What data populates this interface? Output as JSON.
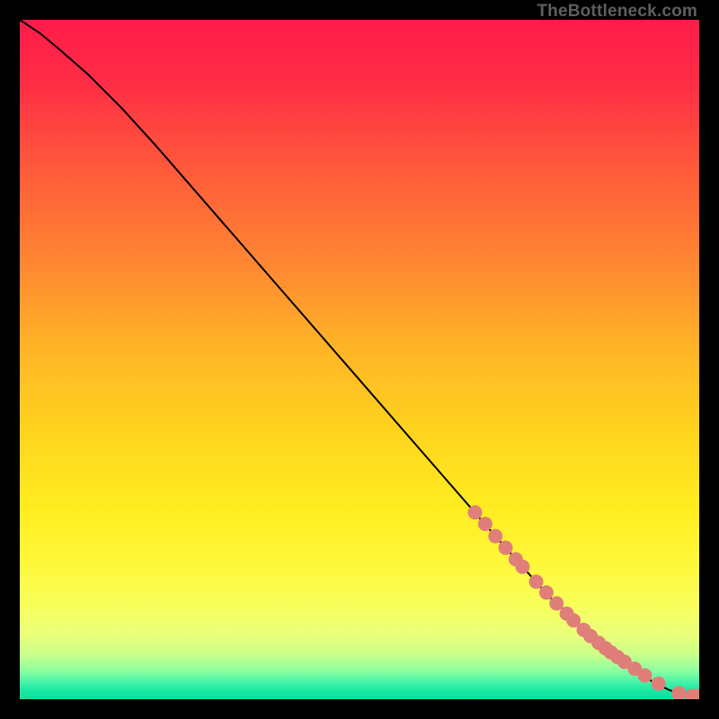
{
  "attribution": "TheBottleneck.com",
  "chart_data": {
    "type": "line",
    "title": "",
    "xlabel": "",
    "ylabel": "",
    "xlim": [
      0,
      100
    ],
    "ylim": [
      0,
      100
    ],
    "background_gradient": {
      "stops": [
        {
          "offset": 0.0,
          "color": "#ff1b4a"
        },
        {
          "offset": 0.1,
          "color": "#ff2f45"
        },
        {
          "offset": 0.22,
          "color": "#ff5a3a"
        },
        {
          "offset": 0.35,
          "color": "#ff8433"
        },
        {
          "offset": 0.48,
          "color": "#ffb327"
        },
        {
          "offset": 0.6,
          "color": "#ffd21e"
        },
        {
          "offset": 0.72,
          "color": "#ffed20"
        },
        {
          "offset": 0.8,
          "color": "#fff83a"
        },
        {
          "offset": 0.86,
          "color": "#f8ff5a"
        },
        {
          "offset": 0.905,
          "color": "#eaff7a"
        },
        {
          "offset": 0.935,
          "color": "#c8ff8a"
        },
        {
          "offset": 0.958,
          "color": "#8dffa0"
        },
        {
          "offset": 0.975,
          "color": "#46f3a8"
        },
        {
          "offset": 0.988,
          "color": "#18e7a3"
        },
        {
          "offset": 1.0,
          "color": "#0fdf9e"
        }
      ]
    },
    "series": [
      {
        "name": "curve",
        "type": "line",
        "color": "#000000",
        "x": [
          0,
          3,
          6,
          10,
          15,
          20,
          30,
          40,
          50,
          60,
          70,
          78,
          84,
          88,
          91,
          93.5,
          95.5,
          97,
          98.2,
          99,
          100
        ],
        "y": [
          100,
          98,
          95.5,
          92,
          87,
          81.5,
          70,
          58.5,
          47,
          35.5,
          24,
          15,
          9.5,
          6,
          3.8,
          2.4,
          1.4,
          0.8,
          0.5,
          0.5,
          0.5
        ]
      },
      {
        "name": "points",
        "type": "scatter",
        "color": "#e07f79",
        "radius": 8,
        "x": [
          67.0,
          68.5,
          70.0,
          71.5,
          73.0,
          74.0,
          76.0,
          77.5,
          79.0,
          80.5,
          81.5,
          83.0,
          84.0,
          85.2,
          86.2,
          87.0,
          88.0,
          89.0,
          90.5,
          92.0,
          94.0,
          97.0,
          99.0,
          100.0
        ],
        "y": [
          27.5,
          25.8,
          24.0,
          22.3,
          20.6,
          19.5,
          17.3,
          15.7,
          14.1,
          12.6,
          11.6,
          10.2,
          9.3,
          8.3,
          7.5,
          6.9,
          6.2,
          5.5,
          4.5,
          3.5,
          2.3,
          0.9,
          0.5,
          0.5
        ]
      }
    ]
  }
}
